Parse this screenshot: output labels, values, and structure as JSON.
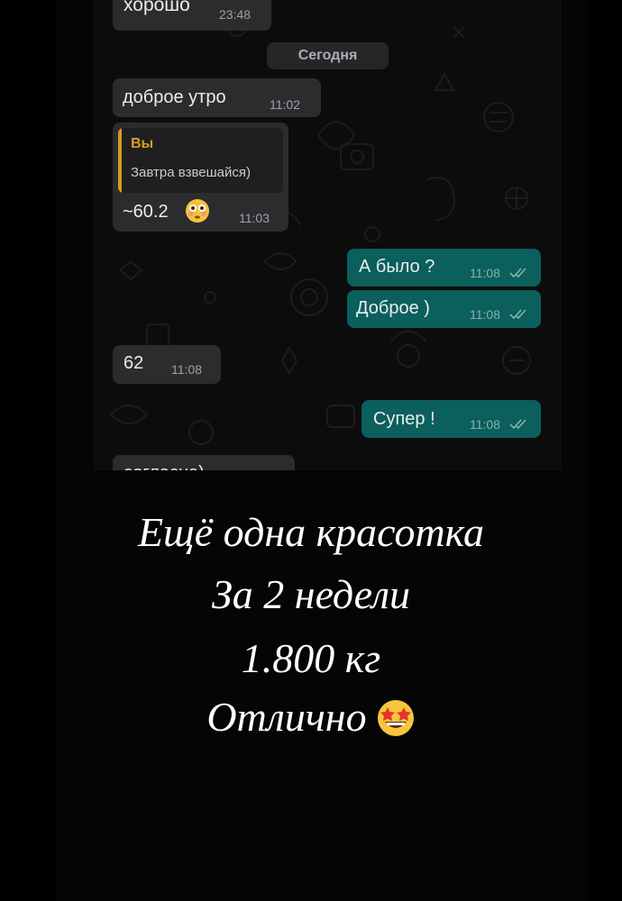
{
  "chat": {
    "top_partial": {
      "text": "хорошо",
      "time": "23:48"
    },
    "date_divider": "Сегодня",
    "messages": [
      {
        "text": "доброе утро",
        "time": "11:02"
      },
      {
        "quote_author": "Вы",
        "quote_text": "Завтра взвешайся)",
        "text": "~60.2",
        "time": "11:03",
        "emoji": "flushed-face"
      },
      {
        "text": "А было ?",
        "time": "11:08",
        "status": "read"
      },
      {
        "text": "Доброе )",
        "time": "11:08",
        "status": "read"
      },
      {
        "text": "62",
        "time": "11:08"
      },
      {
        "text": "Супер !",
        "time": "11:08",
        "status": "read"
      }
    ],
    "bottom_partial": "согласна)"
  },
  "caption": {
    "line1": "Ещё одна красотка",
    "line2": "За 2 недели",
    "line3": "1.800 кг",
    "line4": "Отлично",
    "line4_emoji": "star-struck-face"
  },
  "colors": {
    "incoming_bubble": "#2c2c2e",
    "outgoing_bubble": "#0b5f5c",
    "quote_accent": "#d69d21",
    "read_ticks": "#86b2ae"
  }
}
